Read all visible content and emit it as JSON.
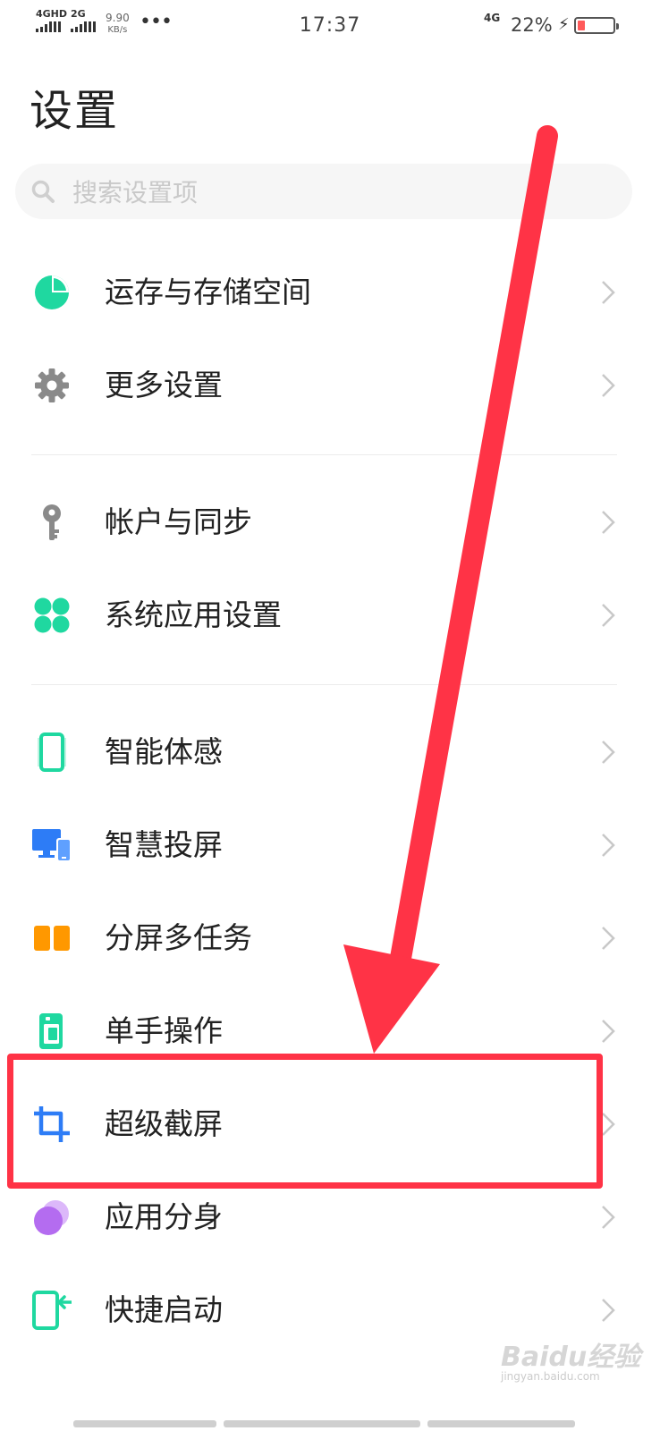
{
  "status_bar": {
    "sim1_label": "4GHD",
    "sim2_label": "2G",
    "net_speed_value": "9.90",
    "net_speed_unit": "KB/s",
    "overflow": "•••",
    "time": "17:37",
    "network": "4G",
    "battery_percent": "22%",
    "battery_level": 0.22,
    "battery_color": "#ff5a5a"
  },
  "page": {
    "title": "设置"
  },
  "search": {
    "placeholder": "搜索设置项",
    "value": ""
  },
  "settings": [
    {
      "label": "运存与存储空间",
      "icon": "storage-pie-icon",
      "color": "#1fd8a0"
    },
    {
      "label": "更多设置",
      "icon": "gear-icon",
      "color": "#8a8a8a"
    },
    {
      "label": "帐户与同步",
      "icon": "key-icon",
      "color": "#8a8a8a"
    },
    {
      "label": "系统应用设置",
      "icon": "clover-icon",
      "color": "#1fd8a0"
    },
    {
      "label": "智能体感",
      "icon": "phone-motion-icon",
      "color": "#1fd8a0"
    },
    {
      "label": "智慧投屏",
      "icon": "screen-cast-icon",
      "color": "#2d7cf6"
    },
    {
      "label": "分屏多任务",
      "icon": "split-screen-icon",
      "color": "#ff9800"
    },
    {
      "label": "单手操作",
      "icon": "one-hand-icon",
      "color": "#1fd8a0"
    },
    {
      "label": "超级截屏",
      "icon": "crop-icon",
      "color": "#2d7cf6"
    },
    {
      "label": "应用分身",
      "icon": "app-clone-icon",
      "color": "#b46cf0"
    },
    {
      "label": "快捷启动",
      "icon": "quick-launch-icon",
      "color": "#1fd8a0"
    }
  ],
  "annotation": {
    "color": "#ff3346"
  },
  "watermark": {
    "text": "Baidu经验",
    "sub": "jingyan.baidu.com"
  }
}
